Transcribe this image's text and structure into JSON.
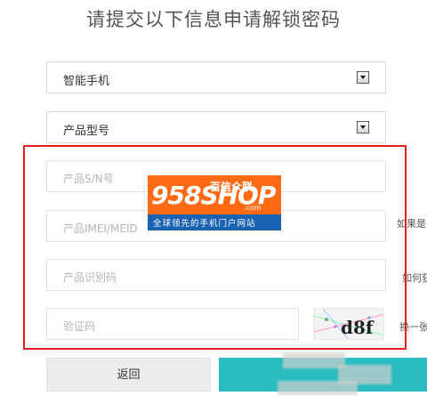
{
  "title": "请提交以下信息申请解锁密码",
  "device_type": {
    "value": "智能手机"
  },
  "product_model": {
    "value": "产品型号"
  },
  "fields": {
    "sn_placeholder": "产品S/N号",
    "imei_placeholder": "产品IMEI/MEID",
    "id_placeholder": "产品识别码",
    "captcha_placeholder": "验证码"
  },
  "side": {
    "imei_hint": "如果是",
    "id_hint": "如何获",
    "captcha_refresh": "换一张"
  },
  "captcha_text": "d8f",
  "buttons": {
    "back": "返回",
    "next": ""
  },
  "watermark": {
    "number": "958",
    "shop": "SHOP",
    "com": ".com",
    "brand": "百信众联",
    "slogan": "全球领先的手机门户网站"
  },
  "colors": {
    "highlight_border": "#e02020",
    "next_button": "#2abcc0",
    "logo_orange": "#ff6a13",
    "logo_blue": "#1a63b3"
  }
}
